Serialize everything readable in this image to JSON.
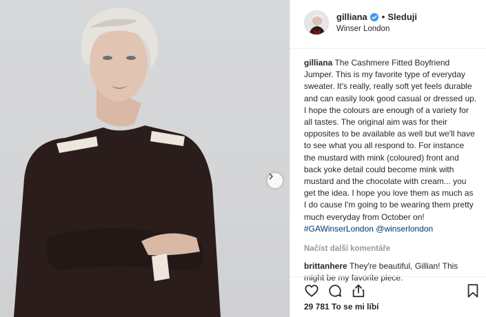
{
  "post": {
    "username": "gilliana",
    "verified": true,
    "separator": "•",
    "follow_label": "Sleduji",
    "location": "Winser London"
  },
  "caption": {
    "user": "gilliana",
    "text": "The Cashmere Fitted Boyfriend Jumper. This is my favorite type of everyday sweater. It's really, really soft yet feels durable and can easily look good casual or dressed up. I hope the colours are enough of a variety for all tastes. The original aim was for their opposites to be available as well but we'll have to see what you all respond to. For instance the mustard with mink (coloured) front and back yoke detail could become mink with mustard and the chocolate with cream... you get the idea. I hope you love them as much as I do cause I'm going to be wearing them pretty much everyday from October on!",
    "hashtag": "#GAWinserLondon",
    "mention": "@winserlondon"
  },
  "load_more_label": "Načíst další komentáře",
  "comments": [
    {
      "user": "brittanhere",
      "text": "They're beautiful, Gillian! This might be my favorite piece."
    }
  ],
  "likes": {
    "count": "29 781",
    "label": "To se mi líbí"
  },
  "icons": {
    "verified": "verified-badge-icon",
    "like": "heart-icon",
    "comment": "comment-bubble-icon",
    "share": "share-icon",
    "save": "bookmark-icon",
    "next": "chevron-right-icon"
  },
  "colors": {
    "verified": "#3897f0",
    "text": "#262626",
    "muted": "#999999",
    "link": "#00376b",
    "border": "#efefef"
  }
}
